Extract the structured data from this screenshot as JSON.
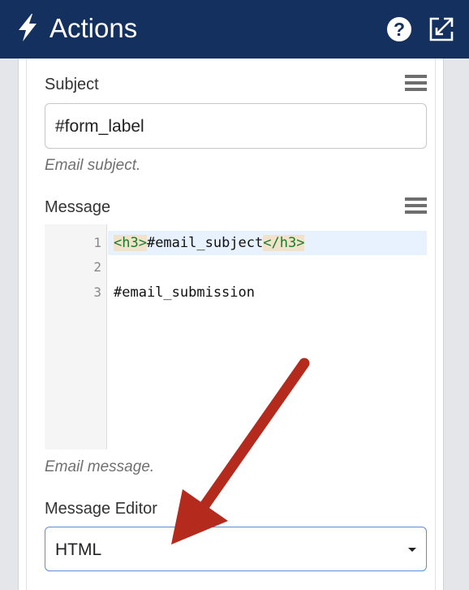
{
  "header": {
    "title": "Actions",
    "help_glyph": "?",
    "bg_color": "#13305e",
    "icons": [
      "bolt-icon",
      "help-icon",
      "expand-icon"
    ]
  },
  "subject": {
    "label": "Subject",
    "value": "#form_label",
    "help": "Email subject."
  },
  "message": {
    "label": "Message",
    "help": "Email message.",
    "lines": [
      {
        "number": "1",
        "tag_open": "<h3>",
        "text": "#email_subject",
        "tag_close": "</h3>"
      },
      {
        "number": "2",
        "text": ""
      },
      {
        "number": "3",
        "text": "#email_submission"
      }
    ]
  },
  "message_editor": {
    "label": "Message Editor",
    "selected": "HTML"
  },
  "annotation": {
    "arrow_color": "#b42a1c"
  }
}
